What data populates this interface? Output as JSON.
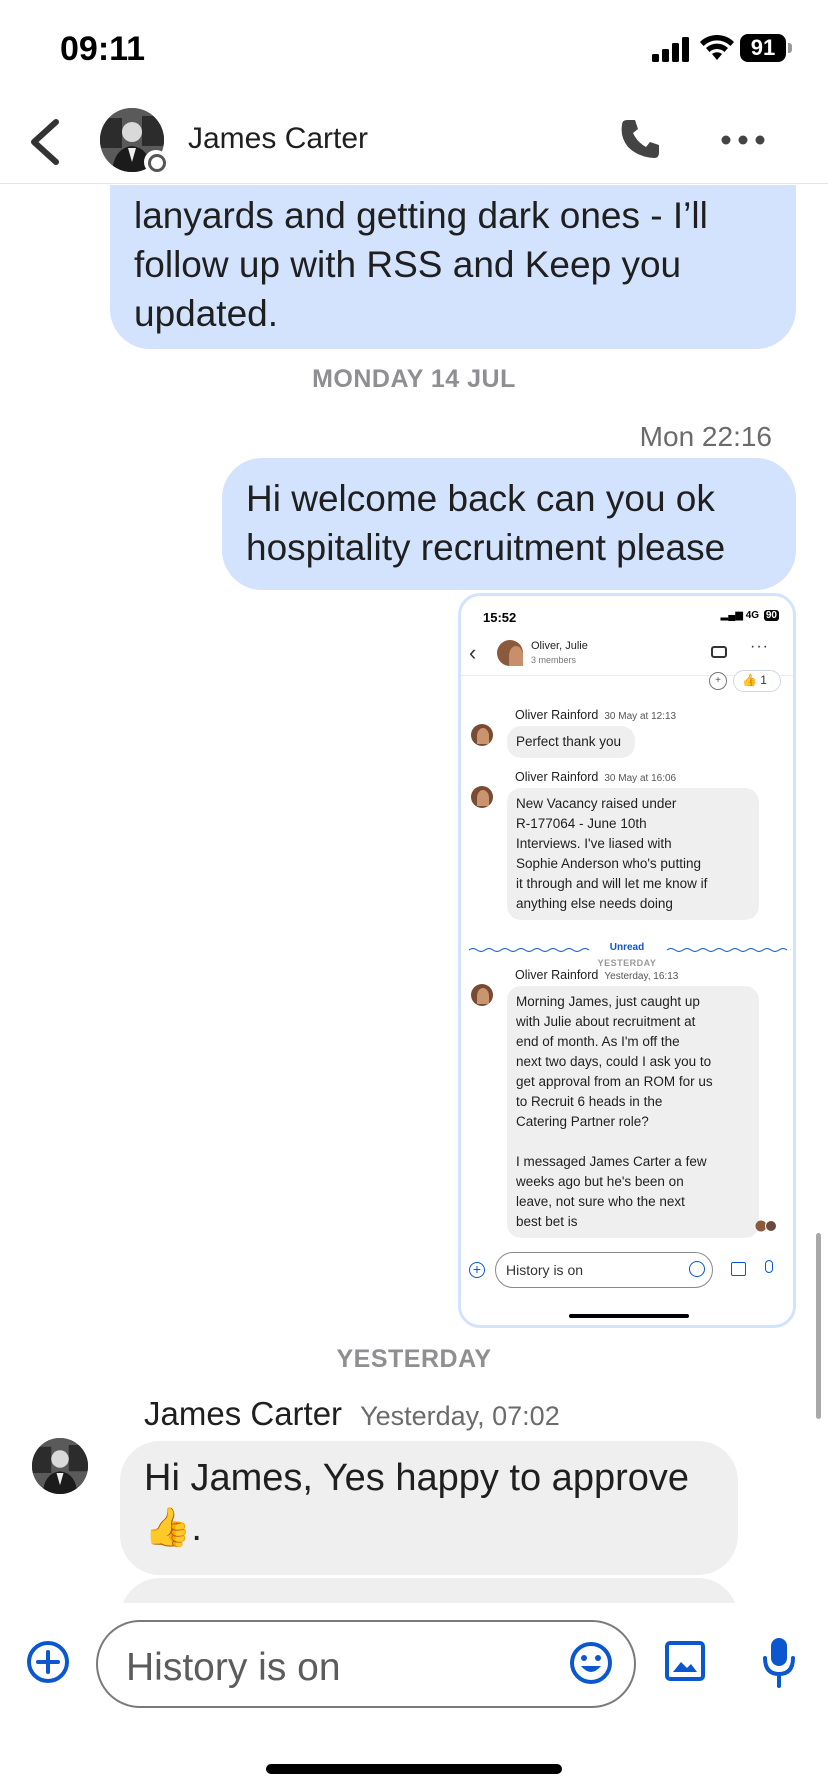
{
  "status_bar": {
    "time": "09:11",
    "battery": "91"
  },
  "header": {
    "title": "James Carter"
  },
  "messages": {
    "outgoing_1": "lanyards and getting dark ones - I’ll follow up with RSS and Keep you updated.",
    "day_divider_1": "MONDAY 14 JUL",
    "outgoing_2_time": "Mon 22:16",
    "outgoing_2": "Hi welcome back can you ok hospitality recruitment please",
    "day_divider_2": "YESTERDAY",
    "incoming_sender": "James Carter",
    "incoming_time": "Yesterday, 07:02",
    "incoming_text": "Hi James, Yes happy to approve 👍."
  },
  "attached_screenshot": {
    "time": "15:52",
    "network": "4G",
    "battery": "90",
    "chat_title": "Oliver, Julie",
    "chat_subtitle": "3 members",
    "reaction": "👍 1",
    "msg1_sender": "Oliver Rainford",
    "msg1_time": "30 May at 12:13",
    "msg1_text": "Perfect thank you",
    "msg2_sender": "Oliver Rainford",
    "msg2_time": "30 May at 16:06",
    "msg2_text": "New Vacancy raised under\nR-177064 - June 10th\nInterviews. I've liased with\nSophie Anderson who's putting\nit through and will let me know if\nanything else needs doing",
    "unread_label": "Unread",
    "yesterday_label": "YESTERDAY",
    "msg3_sender": "Oliver Rainford",
    "msg3_time": "Yesterday, 16:13",
    "msg3_text": "Morning James, just caught up\nwith Julie about recruitment at\nend of month. As I'm off the\nnext two days, could I ask you to\nget approval from an ROM for us\nto Recruit 6 heads in the\nCatering Partner role?\n\nI messaged James Carter a few\nweeks ago but he's been on\nleave, not sure who the next\nbest bet is",
    "composer_placeholder": "History is on"
  },
  "composer": {
    "placeholder": "History is on"
  },
  "icons": {
    "back": "chevron-left-icon",
    "call": "phone-icon",
    "more": "more-horizontal-icon",
    "add": "add-circle-icon",
    "emoji": "emoji-icon",
    "image": "image-icon",
    "mic": "mic-icon"
  },
  "colors": {
    "outgoing_bubble": "#d3e3fd",
    "incoming_bubble": "#efefef",
    "accent": "#0b57d0"
  }
}
